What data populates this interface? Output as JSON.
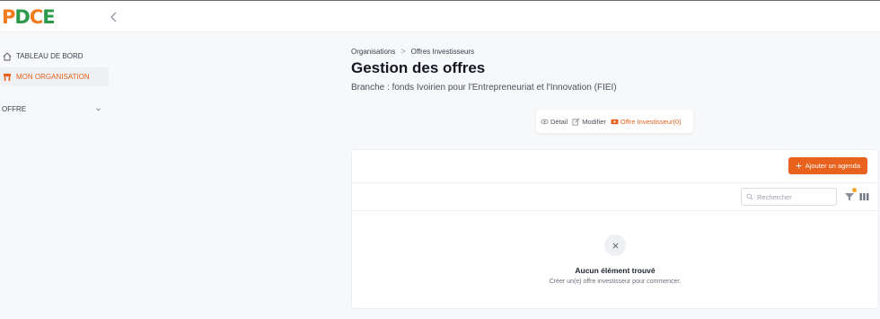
{
  "app": {
    "logo": [
      "P",
      "D",
      "C",
      "E"
    ]
  },
  "sidebar": {
    "items": [
      {
        "label": "TABLEAU DE BORD",
        "icon": "home-icon"
      },
      {
        "label": "MON ORGANISATION",
        "icon": "store-icon",
        "active": true
      },
      {
        "label": "OFFRE",
        "icon": "chevron-down-icon"
      }
    ]
  },
  "breadcrumb": {
    "items": [
      "Organisations",
      "Offres Investisseurs"
    ],
    "separator": ">"
  },
  "page": {
    "title": "Gestion des offres",
    "subtitle": "Branche : fonds Ivoirien pour l'Entrepreneuriat et l'Innovation (FIEI)"
  },
  "tabs": [
    {
      "label": "Détail",
      "icon": "eye-icon"
    },
    {
      "label": "Modifier",
      "icon": "edit-icon"
    },
    {
      "label": "Offre Investisseur(0)",
      "icon": "ticket-icon",
      "active": true
    }
  ],
  "card": {
    "add_label": "Ajouter un agenda",
    "search_placeholder": "Rechercher",
    "empty_title": "Aucun élément trouvé",
    "empty_desc": "Créer un(e) offre investisseur pour commencer."
  },
  "colors": {
    "accent": "#e8621d",
    "logo_green": "#2c9a4a",
    "filter_dot": "#f5a623"
  }
}
